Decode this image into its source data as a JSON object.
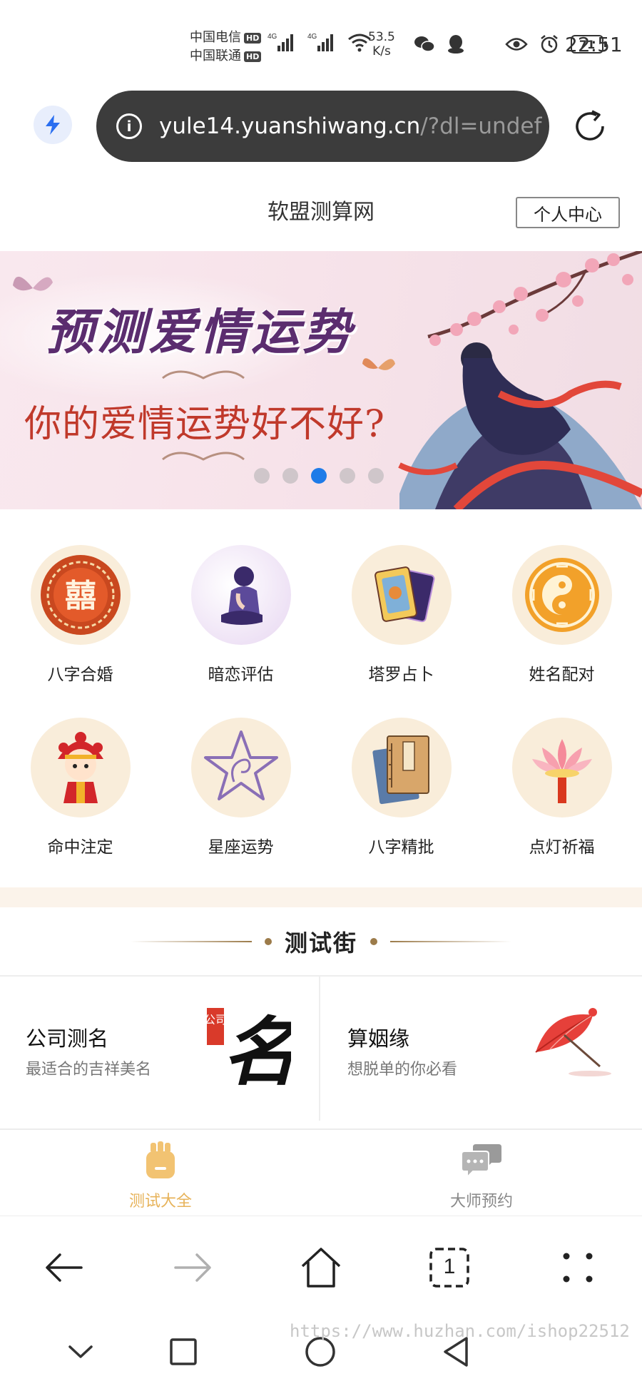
{
  "status_bar": {
    "carrier_1": "中国电信",
    "carrier_2": "中国联通",
    "hd_badge": "HD",
    "signal_label": "4G",
    "net_speed_value": "53.5",
    "net_speed_unit": "K/s",
    "battery": "71",
    "time": "22:51"
  },
  "browser": {
    "url_host": "yule14.yuanshiwang.cn",
    "url_path": "/?dl=undef"
  },
  "header": {
    "title": "软盟测算网",
    "user_center": "个人中心"
  },
  "banner": {
    "heading": "预测爱情运势",
    "subheading": "你的爱情运势好不好?",
    "slide_count": 5,
    "active_slide": 3
  },
  "categories": [
    {
      "label": "八字合婚",
      "icon": "double-happiness-icon"
    },
    {
      "label": "暗恋评估",
      "icon": "sad-girl-icon"
    },
    {
      "label": "塔罗占卜",
      "icon": "tarot-cards-icon"
    },
    {
      "label": "姓名配对",
      "icon": "bagua-icon"
    },
    {
      "label": "命中注定",
      "icon": "bride-icon"
    },
    {
      "label": "星座运势",
      "icon": "star-icon"
    },
    {
      "label": "八字精批",
      "icon": "book-icon"
    },
    {
      "label": "点灯祈福",
      "icon": "lotus-lamp-icon"
    }
  ],
  "section": {
    "title": "测试街"
  },
  "tests": [
    {
      "title": "公司测名",
      "subtitle": "最适合的吉祥美名",
      "art_seal": "公司",
      "art_char": "名"
    },
    {
      "title": "算姻缘",
      "subtitle": "想脱单的你必看"
    }
  ],
  "bottom_nav": {
    "items": [
      {
        "label": "测试大全",
        "active": true
      },
      {
        "label": "大师预约",
        "active": false
      }
    ],
    "colors": {
      "active": "#e7b35a",
      "inactive": "#888888"
    }
  },
  "toolbar": {
    "tab_count": "1"
  },
  "watermark": "https://www.huzhan.com/ishop22512"
}
